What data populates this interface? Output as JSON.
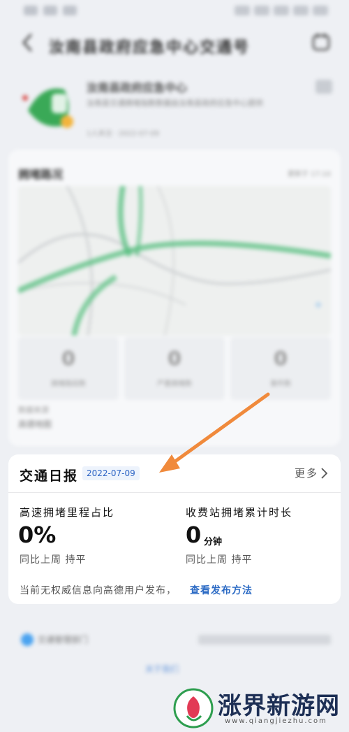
{
  "header": {
    "title": "汝南县政府应急中心交通号"
  },
  "org": {
    "name": "汝南县政府应急中心",
    "description": "汝南县交通拥堵指数数据由汝南县政府应急中心提供",
    "meta": "1人关注 · 2022-07-09"
  },
  "map_card": {
    "title": "拥堵路况",
    "time": "更新于 17:10",
    "stats": [
      {
        "value": "0",
        "label": "拥堵路段数"
      },
      {
        "value": "0",
        "label": "严重拥堵数"
      },
      {
        "value": "0",
        "label": "事件数"
      }
    ],
    "foot1": "数据来源",
    "foot2": "高德地图"
  },
  "report": {
    "title": "交通日报",
    "date": "2022-07-09",
    "more": "更多",
    "metrics": [
      {
        "label": "高速拥堵里程占比",
        "value": "0%",
        "unit": "",
        "compare": "同比上周 持平"
      },
      {
        "label": "收费站拥堵累计时长",
        "value": "0",
        "unit": "分钟",
        "compare": "同比上周 持平"
      }
    ],
    "notice": "当前无权威信息向高德用户发布，",
    "notice_link": "查看发布方法"
  },
  "lower": {
    "row_text": "交通管理部门",
    "link": "关于我们"
  },
  "watermark": {
    "name": "涨界新游网",
    "url": "www.qiangjiezhu.com",
    "logo_color": "#e23a55"
  },
  "colors": {
    "accent_blue": "#2b6ac4",
    "arrow_orange": "#f08a3c",
    "congestion_green": "#3db36b"
  }
}
